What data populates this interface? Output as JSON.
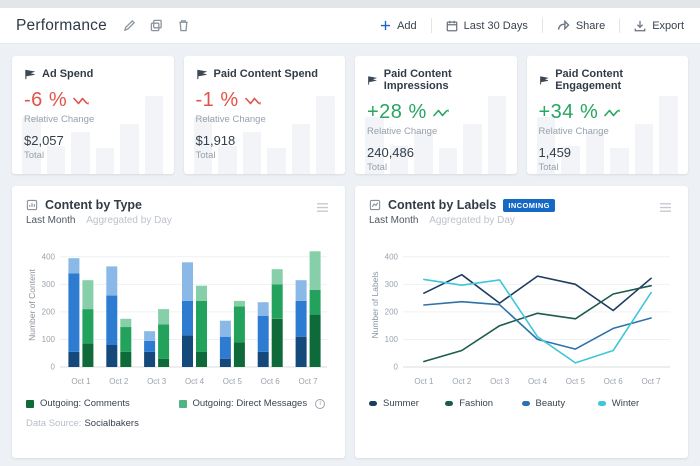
{
  "header": {
    "title": "Performance",
    "buttons": {
      "add": "Add",
      "date_range": "Last 30 Days",
      "share": "Share",
      "export": "Export"
    }
  },
  "kpi_cards": [
    {
      "title": "Ad Spend",
      "icon": "flag-icon",
      "change": "-6 %",
      "direction": "down",
      "change_label": "Relative Change",
      "total": "$2,057",
      "total_label": "Total",
      "spark_bars": [
        48,
        24,
        36,
        22,
        42,
        66
      ]
    },
    {
      "title": "Paid Content Spend",
      "icon": "flag-icon",
      "change": "-1 %",
      "direction": "down",
      "change_label": "Relative Change",
      "total": "$1,918",
      "total_label": "Total",
      "spark_bars": [
        48,
        24,
        36,
        22,
        42,
        66
      ]
    },
    {
      "title": "Paid Content Impressions",
      "icon": "flag-icon",
      "change": "+28 %",
      "direction": "up",
      "change_label": "Relative Change",
      "total": "240,486",
      "total_label": "Total",
      "spark_bars": [
        48,
        24,
        36,
        22,
        42,
        66
      ]
    },
    {
      "title": "Paid Content Engagement",
      "icon": "flag-icon",
      "change": "+34 %",
      "direction": "up",
      "change_label": "Relative Change",
      "total": "1,459",
      "total_label": "Total",
      "spark_bars": [
        48,
        24,
        36,
        22,
        42,
        66
      ]
    }
  ],
  "colors": {
    "negative": "#e0534a",
    "positive": "#27a561",
    "accent_blue": "#1568c4",
    "bar_blue": [
      "#15497c",
      "#2d7cd1",
      "#8ab9e8"
    ],
    "bar_green": [
      "#0e6a39",
      "#22a25c",
      "#86cfa9"
    ]
  },
  "chart_data": [
    {
      "type": "bar",
      "title": "Content by Type",
      "period": "Last Month",
      "aggregation": "Aggregated by Day",
      "ylabel": "Number of Content",
      "categories": [
        "Oct 1",
        "Oct 2",
        "Oct 3",
        "Oct 4",
        "Oct 5",
        "Oct 6",
        "Oct 7"
      ],
      "yticks": [
        0,
        100,
        200,
        300,
        400
      ],
      "ylim": [
        0,
        450
      ],
      "grid": true,
      "bar_groups": [
        {
          "name": "outgoing-blue-stack",
          "colors": [
            "#15497c",
            "#2d7cd1",
            "#8ab9e8"
          ],
          "segments": [
            [
              55,
              285,
              55
            ],
            [
              80,
              180,
              105
            ],
            [
              55,
              40,
              35
            ],
            [
              115,
              125,
              140
            ],
            [
              30,
              80,
              58
            ],
            [
              55,
              130,
              50
            ],
            [
              110,
              130,
              75
            ]
          ]
        },
        {
          "name": "outgoing-green-stack",
          "colors": [
            "#0e6a39",
            "#22a25c",
            "#86cfa9"
          ],
          "segments": [
            [
              85,
              125,
              105
            ],
            [
              55,
              90,
              30
            ],
            [
              30,
              125,
              55
            ],
            [
              55,
              185,
              55
            ],
            [
              90,
              130,
              20
            ],
            [
              175,
              125,
              55
            ],
            [
              190,
              90,
              140
            ]
          ]
        }
      ],
      "legend": [
        {
          "label": "Outgoing: Comments",
          "color": "#0e6a39",
          "info_icon": false
        },
        {
          "label": "Outgoing: Direct Messages",
          "color": "#4eb583",
          "info_icon": true
        }
      ],
      "source_label": "Data Source:",
      "source": "Socialbakers"
    },
    {
      "type": "line",
      "title": "Content by Labels",
      "badge": "INCOMING",
      "period": "Last Month",
      "aggregation": "Aggregated by Day",
      "ylabel": "Number of Labels",
      "categories": [
        "Oct 1",
        "Oct 2",
        "Oct 3",
        "Oct 4",
        "Oct 5",
        "Oct 6",
        "Oct 7"
      ],
      "yticks": [
        0,
        100,
        200,
        300,
        400
      ],
      "ylim": [
        0,
        450
      ],
      "grid": true,
      "legend_position": "bottom",
      "series": [
        {
          "name": "Summer",
          "color": "#1d3d5f",
          "values": [
            268,
            335,
            232,
            330,
            300,
            205,
            322
          ]
        },
        {
          "name": "Fashion",
          "color": "#1d5b4f",
          "values": [
            20,
            60,
            150,
            195,
            175,
            265,
            295
          ]
        },
        {
          "name": "Beauty",
          "color": "#2f72ab",
          "values": [
            225,
            237,
            226,
            100,
            65,
            140,
            178
          ]
        },
        {
          "name": "Winter",
          "color": "#3ec6d9",
          "values": [
            318,
            297,
            316,
            110,
            15,
            60,
            270
          ]
        }
      ]
    }
  ]
}
